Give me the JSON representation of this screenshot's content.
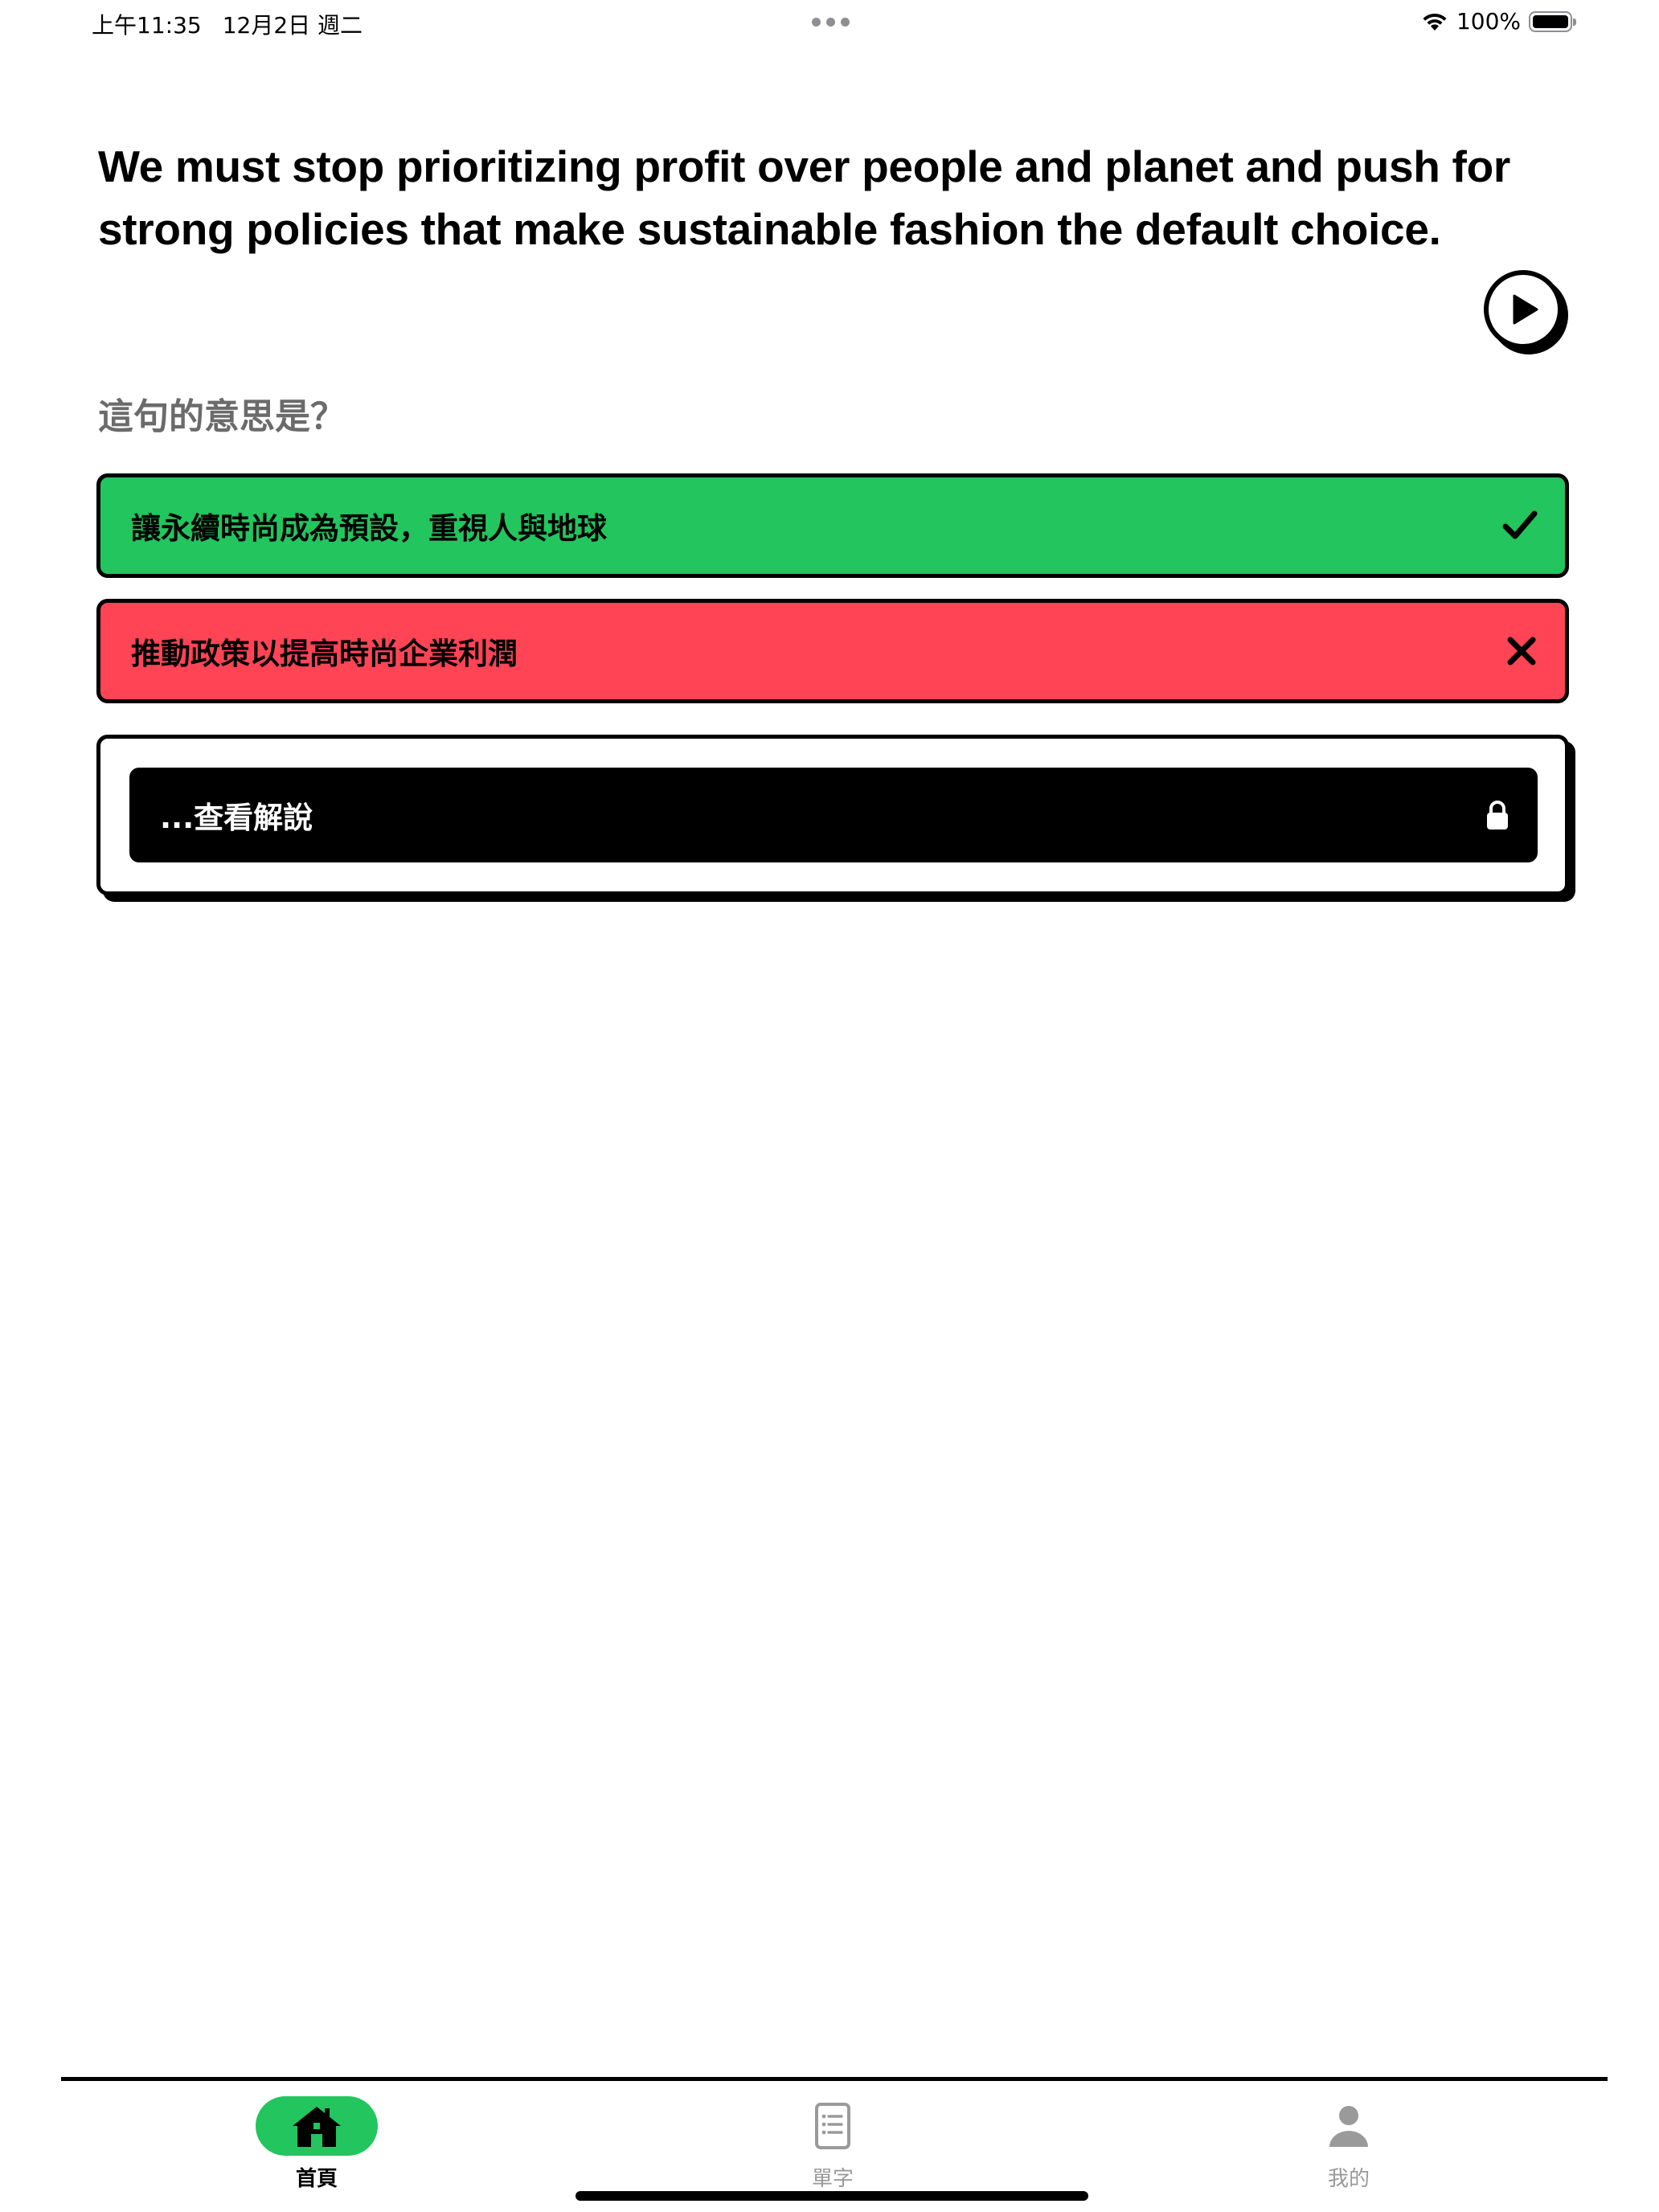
{
  "status_bar": {
    "time": "上午11:35",
    "date": "12月2日 週二",
    "battery": "100%"
  },
  "lesson": {
    "sentence": "We must stop prioritizing profit over people and planet and push for strong policies that make sustainable fashion the default choice.",
    "question": "這句的意思是？",
    "options": [
      {
        "label": "讓永續時尚成為預設，重視人與地球",
        "state": "correct",
        "color": "#22c55e"
      },
      {
        "label": "推動政策以提高時尚企業利潤",
        "state": "wrong",
        "color": "#ff4455"
      }
    ],
    "explanation_label": "...查看解說"
  },
  "tab_bar": {
    "tabs": [
      {
        "label": "首頁",
        "icon": "home-icon",
        "active": true
      },
      {
        "label": "單字",
        "icon": "notebook-icon",
        "active": false
      },
      {
        "label": "我的",
        "icon": "person-icon",
        "active": false
      }
    ],
    "accent_color": "#22c55e"
  }
}
